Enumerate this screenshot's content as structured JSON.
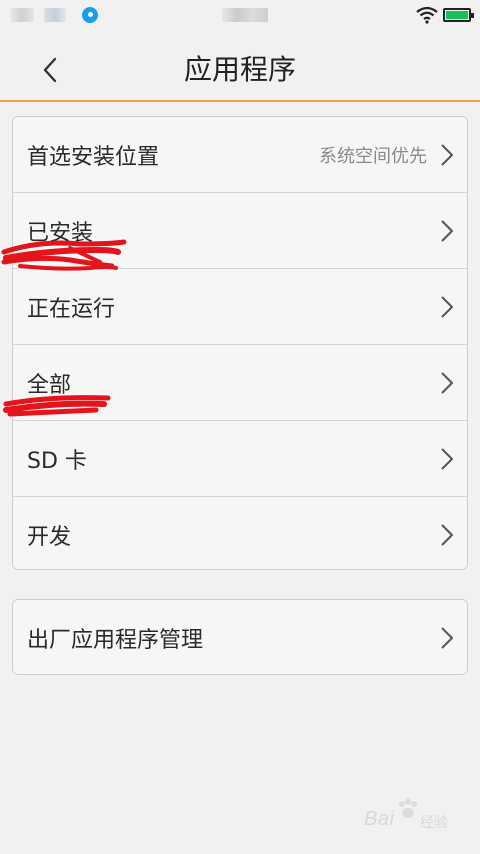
{
  "header": {
    "title": "应用程序"
  },
  "settings_group": {
    "items": [
      {
        "label": "首选安装位置",
        "value": "系统空间优先"
      },
      {
        "label": "已安装"
      },
      {
        "label": "正在运行"
      },
      {
        "label": "全部"
      },
      {
        "label": "SD 卡"
      },
      {
        "label": "开发"
      }
    ]
  },
  "factory_group": {
    "items": [
      {
        "label": "出厂应用程序管理"
      }
    ]
  },
  "watermark": {
    "text": "Bai",
    "sub": "经验"
  },
  "colors": {
    "accent_line": "#f0a04b",
    "battery": "#15c25a",
    "annotation": "#e3141b"
  },
  "icons": {
    "back": "chevron-left-icon",
    "row_arrow": "chevron-right-icon",
    "wifi": "wifi-icon",
    "battery": "battery-icon"
  }
}
